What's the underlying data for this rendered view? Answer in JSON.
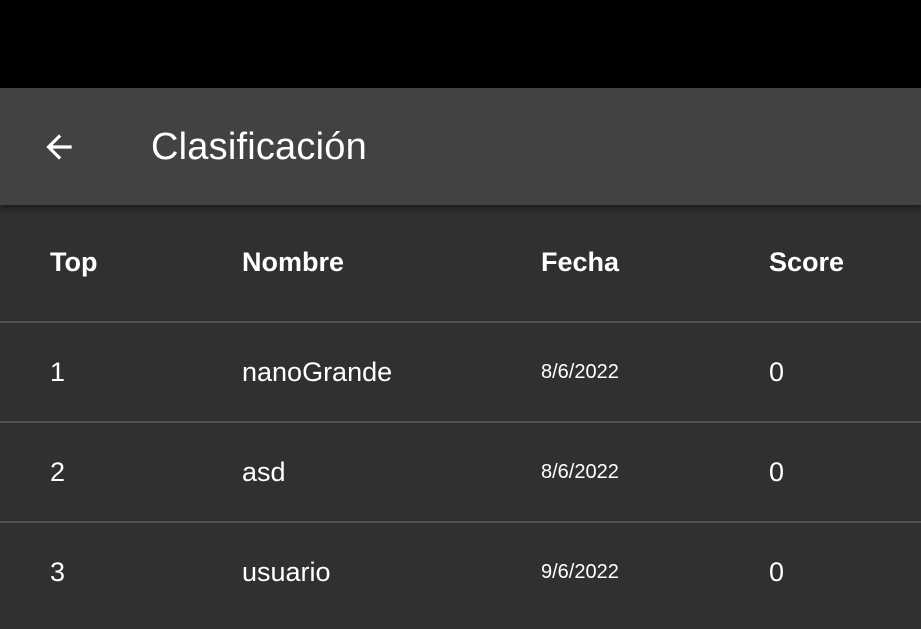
{
  "app_bar": {
    "title": "Clasificación",
    "back_icon": "arrow-back-icon"
  },
  "table": {
    "headers": {
      "top": "Top",
      "name": "Nombre",
      "date": "Fecha",
      "score": "Score"
    },
    "rows": [
      {
        "top": "1",
        "name": "nanoGrande",
        "date": "8/6/2022",
        "score": "0"
      },
      {
        "top": "2",
        "name": "asd",
        "date": "8/6/2022",
        "score": "0"
      },
      {
        "top": "3",
        "name": "usuario",
        "date": "9/6/2022",
        "score": "0"
      }
    ]
  },
  "colors": {
    "status_bar": "#000000",
    "app_bar": "#424242",
    "background": "#303030",
    "divider": "#515151",
    "text": "#ffffff"
  }
}
